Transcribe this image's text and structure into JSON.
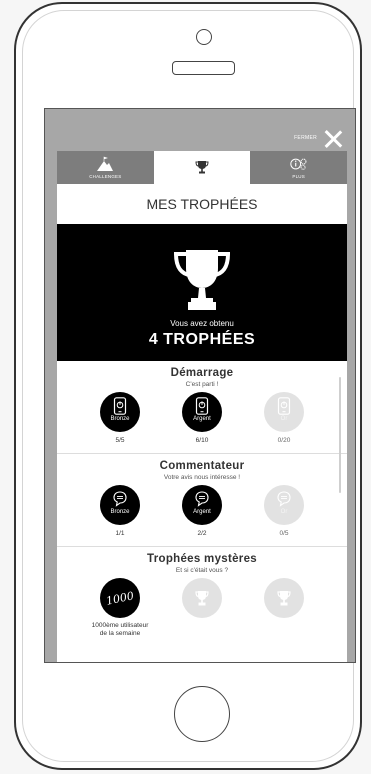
{
  "header": {
    "close_label": "FERMER"
  },
  "tabs": [
    {
      "label": "CHALLENGES",
      "icon": "mountain-flag-icon"
    },
    {
      "label": "",
      "icon": "trophy-icon"
    },
    {
      "label": "PLUS",
      "icon": "more-info-gear-icon"
    }
  ],
  "page_title": "MES TROPHÉES",
  "hero": {
    "subtitle": "Vous avez obtenu",
    "count": "4 TROPHÉES"
  },
  "sections": [
    {
      "title": "Démarrage",
      "subtitle": "C'est parti !",
      "badges": [
        {
          "label": "Bronze",
          "progress": "5/5",
          "state": "earned"
        },
        {
          "label": "Argent",
          "progress": "6/10",
          "state": "earned"
        },
        {
          "label": "Or",
          "progress": "0/20",
          "state": "locked"
        }
      ]
    },
    {
      "title": "Commentateur",
      "subtitle": "Votre avis nous intéresse !",
      "badges": [
        {
          "label": "Bronze",
          "progress": "1/1",
          "state": "earned"
        },
        {
          "label": "Argent",
          "progress": "2/2",
          "state": "earned"
        },
        {
          "label": "Or",
          "progress": "0/5",
          "state": "locked"
        }
      ]
    },
    {
      "title": "Trophées mystères",
      "subtitle": "Et si c'était vous ?",
      "badges": [
        {
          "label": "1000",
          "caption_line1": "1000ème utilisateur",
          "caption_line2": "de la semaine",
          "state": "earned"
        },
        {
          "state": "locked"
        },
        {
          "state": "locked"
        }
      ]
    }
  ],
  "colors": {
    "dark": "#000000",
    "locked": "#e2e2e2",
    "tab_inactive": "#7d7d7d",
    "overlay": "#a7a7a7"
  }
}
